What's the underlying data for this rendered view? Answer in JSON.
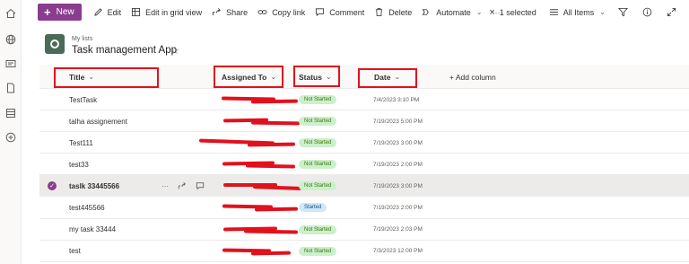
{
  "toolbar": {
    "new_label": "New",
    "edit_label": "Edit",
    "edit_grid_label": "Edit in grid view",
    "share_label": "Share",
    "copy_link_label": "Copy link",
    "comment_label": "Comment",
    "delete_label": "Delete",
    "automate_label": "Automate",
    "more_label": "···",
    "selected_label": "1 selected",
    "view_label": "All Items"
  },
  "header": {
    "breadcrumb": "My lists",
    "title": "Task management App"
  },
  "columns": {
    "title": "Title",
    "assigned": "Assigned To",
    "status": "Status",
    "date": "Date",
    "add_column": "+ Add column"
  },
  "rows": [
    {
      "title": "TestTask",
      "status": "Not Started",
      "date": "7/4/2023 3:10 PM"
    },
    {
      "title": "talha assignement",
      "status": "Not Started",
      "date": "7/19/2023 5:00 PM"
    },
    {
      "title": "Test111",
      "status": "Not Started",
      "date": "7/19/2023 3:00 PM"
    },
    {
      "title": "test33",
      "status": "Not Started",
      "date": "7/19/2023 2:00 PM"
    },
    {
      "title": "taslk 33445566",
      "status": "Not Started",
      "date": "7/19/2023 3:00 PM"
    },
    {
      "title": "test445566",
      "status": "Started",
      "date": "7/19/2023 2:00 PM"
    },
    {
      "title": "my task 33444",
      "status": "Not Started",
      "date": "7/19/2023 2:03 PM"
    },
    {
      "title": "test",
      "status": "Not Started",
      "date": "7/3/2023 12:00 PM"
    }
  ],
  "colors": {
    "accent": "#8a3d8e",
    "annotation_red": "#e3101d",
    "not_started_bg": "#caf0cc",
    "started_bg": "#d0e7f8"
  }
}
